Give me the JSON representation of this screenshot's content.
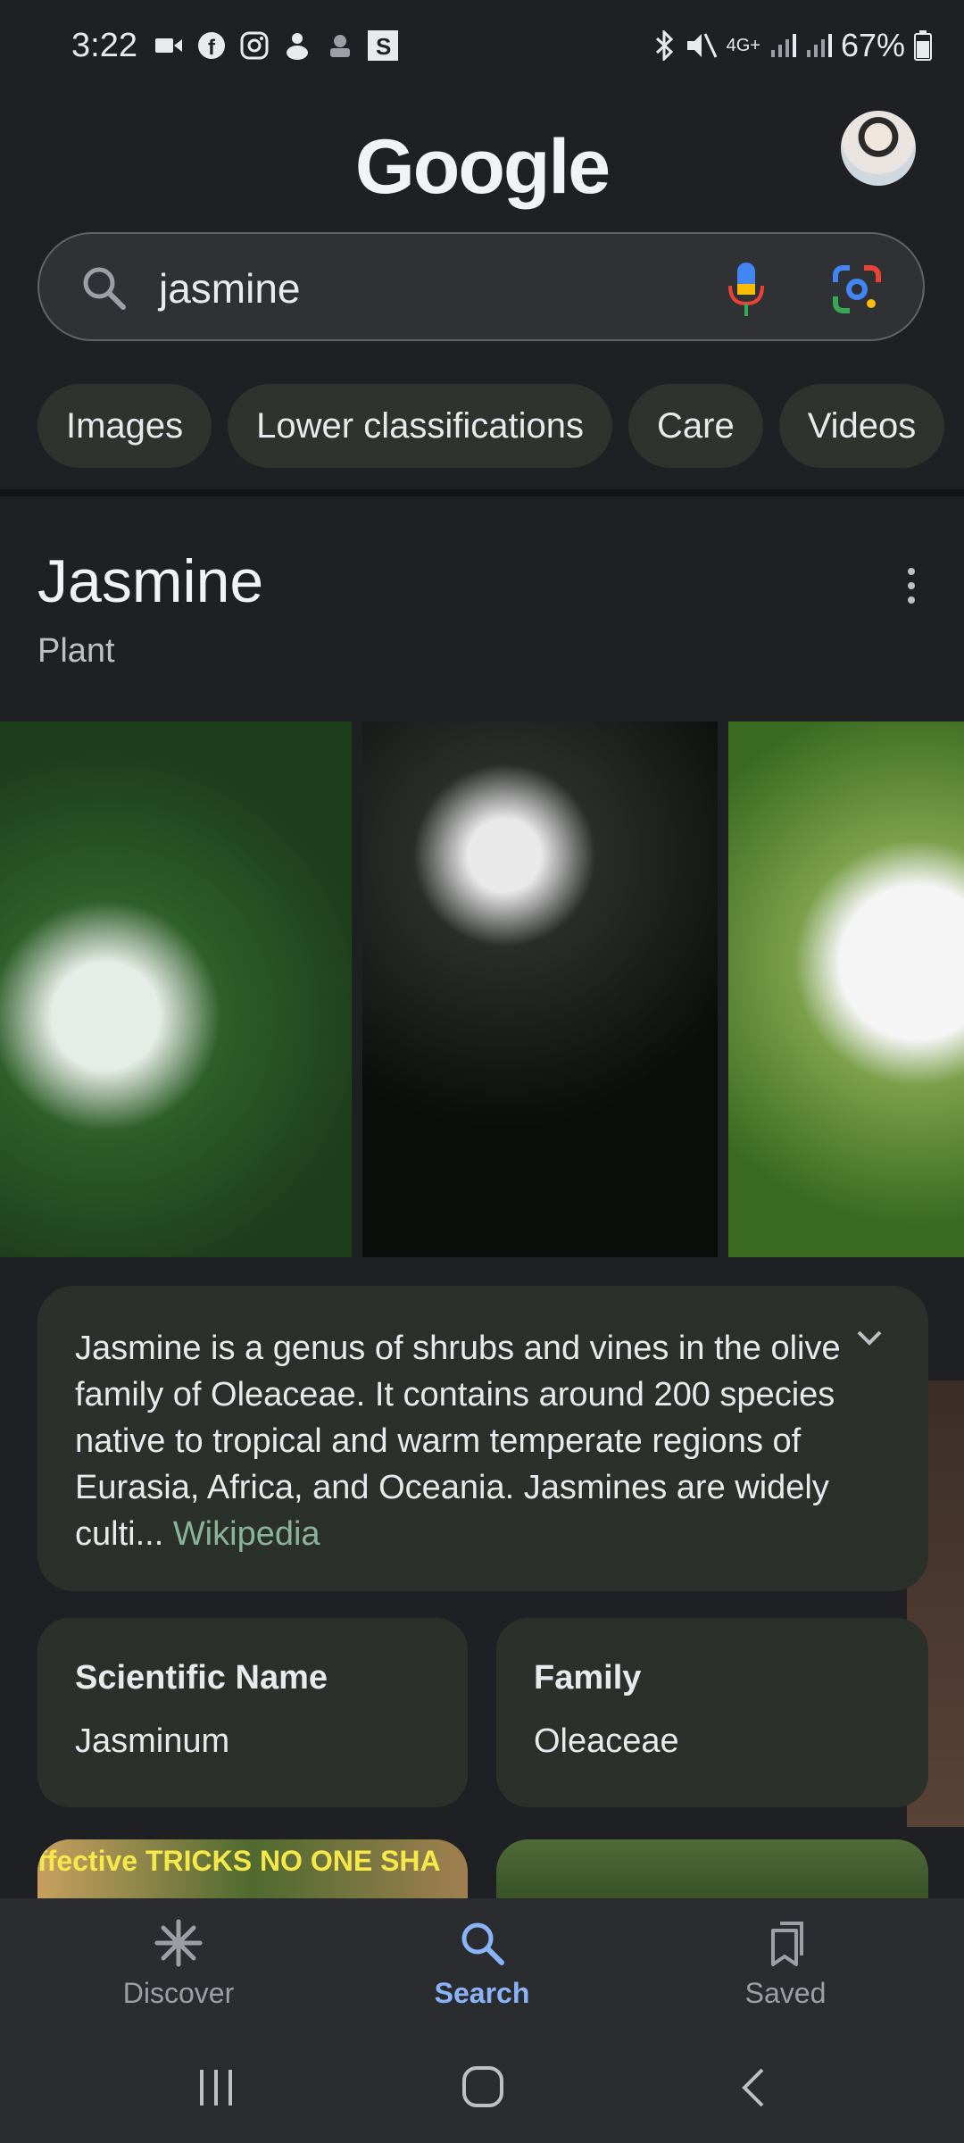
{
  "status_bar": {
    "time": "3:22",
    "battery": "67%",
    "network": "4G+"
  },
  "header": {
    "logo_text": "Google"
  },
  "search": {
    "query": "jasmine"
  },
  "chips": [
    "Images",
    "Lower classifications",
    "Care",
    "Videos"
  ],
  "knowledge_panel": {
    "title": "Jasmine",
    "subtitle": "Plant",
    "description": "Jasmine is a genus of shrubs and vines in the olive family of Oleaceae. It contains around 200 species native to tropical and warm temperate regions of Eurasia, Africa, and Oceania. Jasmines are widely culti",
    "source_label": "Wikipedia",
    "facts": [
      {
        "label": "Scientific Name",
        "value": "Jasminum"
      },
      {
        "label": "Family",
        "value": "Oleaceae"
      }
    ],
    "video_thumb_text": "ffective TRICKS NO ONE SHA"
  },
  "bottom_nav": {
    "items": [
      {
        "label": "Discover",
        "icon": "asterisk-icon"
      },
      {
        "label": "Search",
        "icon": "search-icon"
      },
      {
        "label": "Saved",
        "icon": "bookmarks-icon"
      }
    ],
    "active": "Search"
  },
  "colors": {
    "background": "#1f2023",
    "card": "#2b302b",
    "accent_blue": "#8ab4f8",
    "wiki_link": "#8ab49a"
  }
}
